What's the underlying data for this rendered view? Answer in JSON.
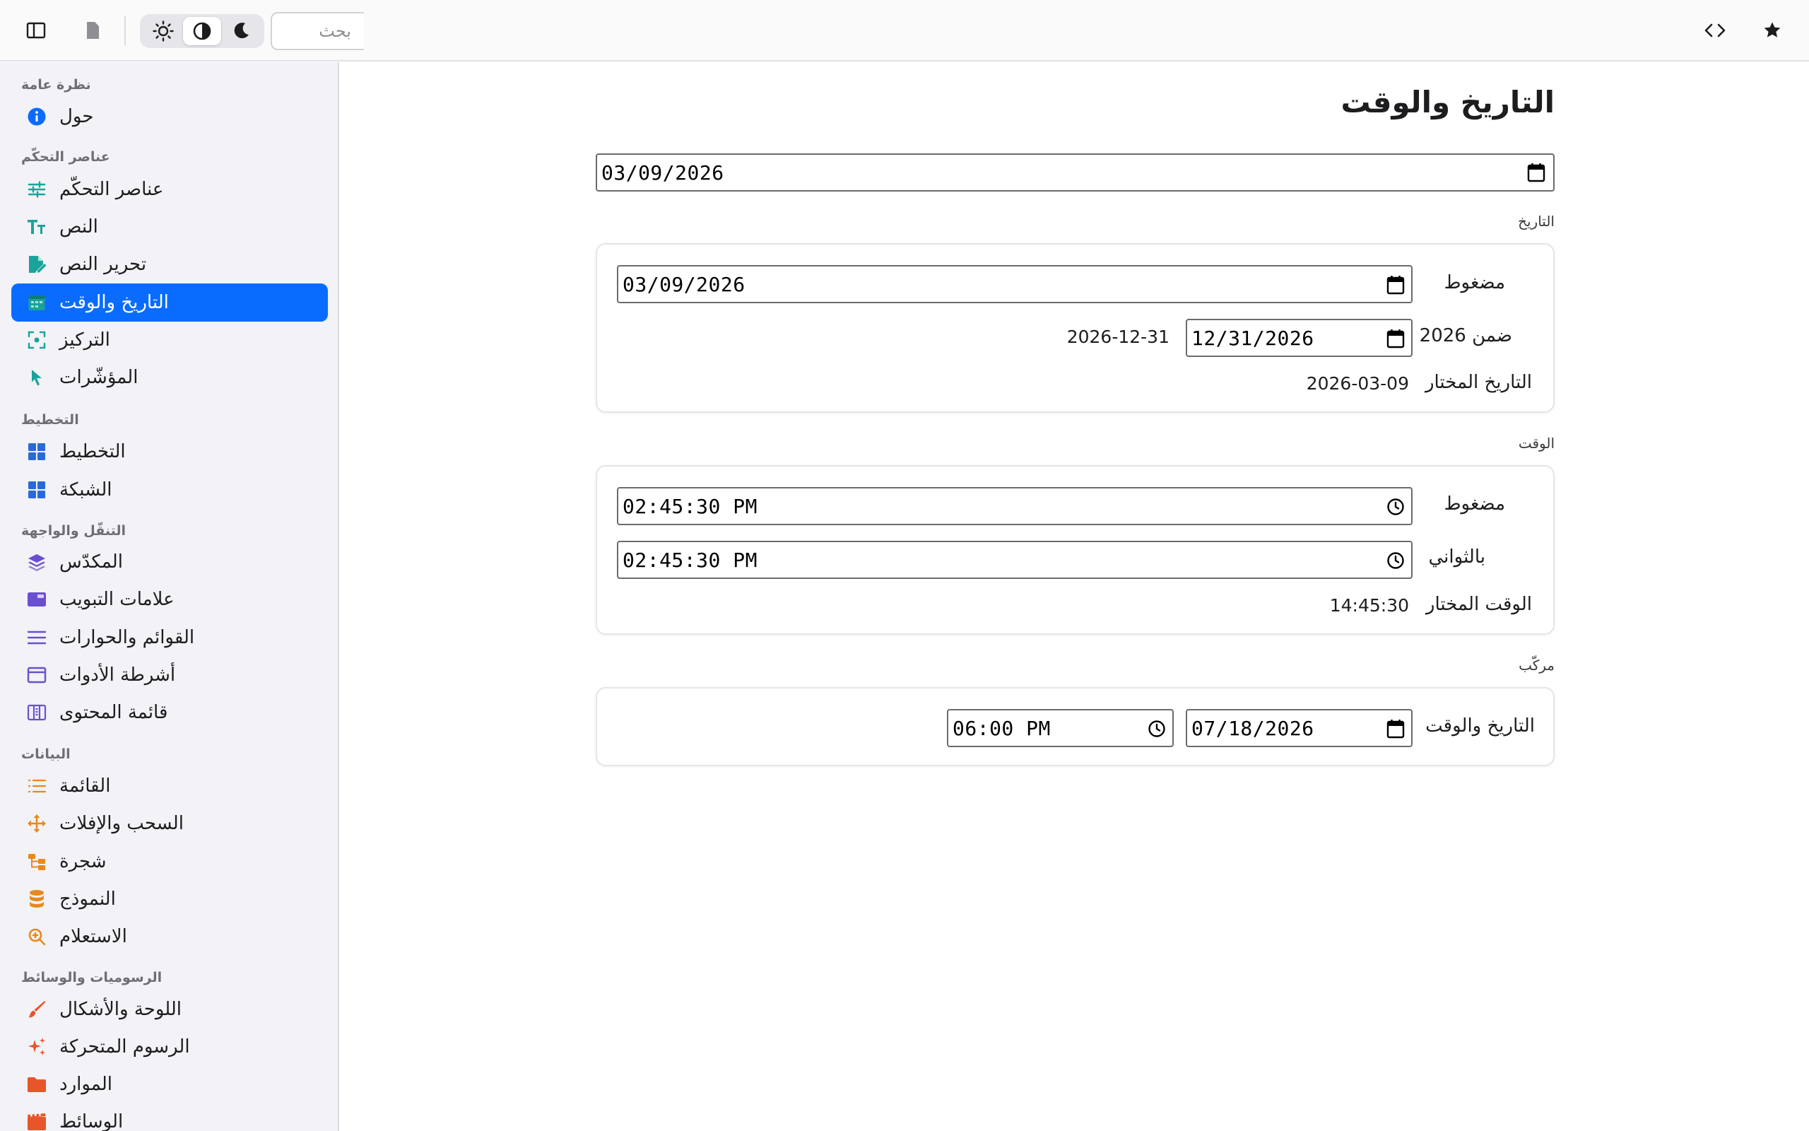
{
  "toolbar": {
    "search_placeholder": "بحث",
    "icons": [
      "sidebar-toggle-icon",
      "document-icon",
      "sun-icon",
      "contrast-icon",
      "moon-icon",
      "code-icon",
      "star-icon"
    ]
  },
  "sidebar": {
    "sections": {
      "overview": "نظرة عامة",
      "controls": "عناصر التحكّم",
      "layout": "التخطيط",
      "navigation": "التنقّل والواجهة",
      "data": "البيانات",
      "graphics": "الرسوميات والوسائط"
    },
    "items": [
      {
        "label": "حول",
        "icon": "info-icon",
        "color": "#0a6cff"
      },
      {
        "label": "عناصر التحكّم",
        "icon": "sliders-icon",
        "color": "#1aa39a"
      },
      {
        "label": "النص",
        "icon": "text-size-icon",
        "color": "#1aa39a"
      },
      {
        "label": "تحرير النص",
        "icon": "edit-document-icon",
        "color": "#1aa39a"
      },
      {
        "label": "التاريخ والوقت",
        "icon": "calendar-icon",
        "color": "#1aa39a"
      },
      {
        "label": "التركيز",
        "icon": "focus-icon",
        "color": "#1aa39a"
      },
      {
        "label": "المؤشّرات",
        "icon": "pointer-icon",
        "color": "#1aa39a"
      },
      {
        "label": "التخطيط",
        "icon": "grid-icon",
        "color": "#2a6ad6"
      },
      {
        "label": "الشبكة",
        "icon": "grid-icon",
        "color": "#2a6ad6"
      },
      {
        "label": "المكدّس",
        "icon": "stack-icon",
        "color": "#6a4fd1"
      },
      {
        "label": "علامات التبويب",
        "icon": "tabs-icon",
        "color": "#6a4fd1"
      },
      {
        "label": "القوائم والحوارات",
        "icon": "menu-icon",
        "color": "#6a4fd1"
      },
      {
        "label": "أشرطة الأدوات",
        "icon": "window-icon",
        "color": "#6a4fd1"
      },
      {
        "label": "قائمة المحتوى",
        "icon": "columns-icon",
        "color": "#6a4fd1"
      },
      {
        "label": "القائمة",
        "icon": "list-icon",
        "color": "#e8891c"
      },
      {
        "label": "السحب والإفلات",
        "icon": "move-icon",
        "color": "#e8891c"
      },
      {
        "label": "شجرة",
        "icon": "tree-icon",
        "color": "#e8891c"
      },
      {
        "label": "النموذج",
        "icon": "database-icon",
        "color": "#e8891c"
      },
      {
        "label": "الاستعلام",
        "icon": "zoom-icon",
        "color": "#e8891c"
      },
      {
        "label": "اللوحة والأشكال",
        "icon": "brush-icon",
        "color": "#e8552a"
      },
      {
        "label": "الرسوم المتحركة",
        "icon": "sparkles-icon",
        "color": "#e8552a"
      },
      {
        "label": "الموارد",
        "icon": "folder-icon",
        "color": "#e8552a"
      },
      {
        "label": "الوسائط",
        "icon": "film-icon",
        "color": "#e8552a"
      }
    ]
  },
  "main": {
    "title": "التاريخ والوقت",
    "top_date": "03/09/2026",
    "date_section": {
      "label": "التاريخ",
      "compact_label": "مضغوط",
      "compact_value": "03/09/2026",
      "within_label": "ضمن 2026",
      "within_value": "12/31/2026",
      "within_text": "2026-12-31",
      "selected_label": "التاريخ المختار",
      "selected_value": "2026-03-09"
    },
    "time_section": {
      "label": "الوقت",
      "compact_label": "مضغوط",
      "compact_value": "02:45:30 PM",
      "seconds_label": "بالثواني",
      "seconds_value": "02:45:30 PM",
      "selected_label": "الوقت المختار",
      "selected_value": "14:45:30"
    },
    "combined_section": {
      "label": "مركّب",
      "row_label": "التاريخ والوقت",
      "date_value": "07/18/2026",
      "time_value": "06:00 PM"
    }
  },
  "colors": {
    "accent": "#0a6cff",
    "sidebar_bg": "#f2f2f7"
  }
}
